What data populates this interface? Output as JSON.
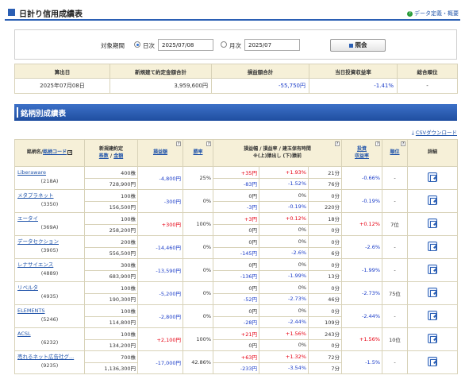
{
  "header": {
    "title": "日計り信用成績表",
    "help_link": "データ定義・概要"
  },
  "filter": {
    "label": "対象期間",
    "daily_label": "日次",
    "daily_value": "2025/07/08",
    "monthly_label": "月次",
    "monthly_value": "2025/07",
    "submit_label": "照会"
  },
  "summary": {
    "headers": [
      "算出日",
      "新規建て約定金額合計",
      "損益額合計",
      "当日投資収益率",
      "総合順位"
    ],
    "row": [
      "2025年07月08日",
      "3,959,600円",
      "-55,750円",
      "-1.41%",
      "-"
    ]
  },
  "section_title": "銘柄別成績表",
  "csv_label": "CSVダウンロード",
  "table": {
    "headers": {
      "name_a": "銘柄名",
      "name_b": "銘柄コード",
      "amount_a": "新規建約定",
      "amount_b": "株数",
      "amount_c": "金額",
      "pnl": "損益額",
      "win": "勝率",
      "range_a": "損益幅 / 損益率 / 建玉保有時間",
      "range_b": "※(上)猿出し (下)猿前",
      "roi_a": "投資",
      "roi_b": "収益率",
      "rank": "順位",
      "detail": "詳細"
    },
    "rows": [
      {
        "name": "Liberaware",
        "code": "(218A)",
        "shares": "400株",
        "amount": "728,900円",
        "pnl": "-4,800円",
        "pnl_c": "blue",
        "win": "25%",
        "up_amt": "+35円",
        "up_amt_c": "red",
        "up_rate": "+1.93%",
        "up_rate_c": "red",
        "up_time": "21分",
        "dn_amt": "-83円",
        "dn_amt_c": "blue",
        "dn_rate": "-1.52%",
        "dn_rate_c": "blue",
        "dn_time": "76分",
        "roi": "-0.66%",
        "roi_c": "blue",
        "rank": "-"
      },
      {
        "name": "メタプラネット",
        "code": "(3350)",
        "shares": "100株",
        "amount": "156,500円",
        "pnl": "-300円",
        "pnl_c": "blue",
        "win": "0%",
        "up_amt": "0円",
        "up_amt_c": "",
        "up_rate": "0%",
        "up_rate_c": "",
        "up_time": "0分",
        "dn_amt": "-3円",
        "dn_amt_c": "blue",
        "dn_rate": "-0.19%",
        "dn_rate_c": "blue",
        "dn_time": "220分",
        "roi": "-0.19%",
        "roi_c": "blue",
        "rank": "-"
      },
      {
        "name": "エータイ",
        "code": "(369A)",
        "shares": "100株",
        "amount": "258,200円",
        "pnl": "+300円",
        "pnl_c": "red",
        "win": "100%",
        "up_amt": "+3円",
        "up_amt_c": "red",
        "up_rate": "+0.12%",
        "up_rate_c": "red",
        "up_time": "18分",
        "dn_amt": "0円",
        "dn_amt_c": "",
        "dn_rate": "0%",
        "dn_rate_c": "",
        "dn_time": "0分",
        "roi": "+0.12%",
        "roi_c": "red",
        "rank": "7位"
      },
      {
        "name": "データセクション",
        "code": "(3905)",
        "shares": "200株",
        "amount": "556,500円",
        "pnl": "-14,460円",
        "pnl_c": "blue",
        "win": "0%",
        "up_amt": "0円",
        "up_amt_c": "",
        "up_rate": "0%",
        "up_rate_c": "",
        "up_time": "0分",
        "dn_amt": "-145円",
        "dn_amt_c": "blue",
        "dn_rate": "-2.6%",
        "dn_rate_c": "blue",
        "dn_time": "6分",
        "roi": "-2.6%",
        "roi_c": "blue",
        "rank": "-"
      },
      {
        "name": "レナサイエンス",
        "code": "(4889)",
        "shares": "300株",
        "amount": "683,900円",
        "pnl": "-13,590円",
        "pnl_c": "blue",
        "win": "0%",
        "up_amt": "0円",
        "up_amt_c": "",
        "up_rate": "0%",
        "up_rate_c": "",
        "up_time": "0分",
        "dn_amt": "-136円",
        "dn_amt_c": "blue",
        "dn_rate": "-1.99%",
        "dn_rate_c": "blue",
        "dn_time": "13分",
        "roi": "-1.99%",
        "roi_c": "blue",
        "rank": "-"
      },
      {
        "name": "リベルタ",
        "code": "(4935)",
        "shares": "100株",
        "amount": "190,300円",
        "pnl": "-5,200円",
        "pnl_c": "blue",
        "win": "0%",
        "up_amt": "0円",
        "up_amt_c": "",
        "up_rate": "0%",
        "up_rate_c": "",
        "up_time": "0分",
        "dn_amt": "-52円",
        "dn_amt_c": "blue",
        "dn_rate": "-2.73%",
        "dn_rate_c": "blue",
        "dn_time": "46分",
        "roi": "-2.73%",
        "roi_c": "blue",
        "rank": "75位"
      },
      {
        "name": "ELEMENTS",
        "code": "(5246)",
        "shares": "100株",
        "amount": "114,800円",
        "pnl": "-2,800円",
        "pnl_c": "blue",
        "win": "0%",
        "up_amt": "0円",
        "up_amt_c": "",
        "up_rate": "0%",
        "up_rate_c": "",
        "up_time": "0分",
        "dn_amt": "-28円",
        "dn_amt_c": "blue",
        "dn_rate": "-2.44%",
        "dn_rate_c": "blue",
        "dn_time": "109分",
        "roi": "-2.44%",
        "roi_c": "blue",
        "rank": "-"
      },
      {
        "name": "ACSL",
        "code": "(6232)",
        "shares": "100株",
        "amount": "134,200円",
        "pnl": "+2,100円",
        "pnl_c": "red",
        "win": "100%",
        "up_amt": "+21円",
        "up_amt_c": "red",
        "up_rate": "+1.56%",
        "up_rate_c": "red",
        "up_time": "243分",
        "dn_amt": "0円",
        "dn_amt_c": "",
        "dn_rate": "0%",
        "dn_rate_c": "",
        "dn_time": "0分",
        "roi": "+1.56%",
        "roi_c": "red",
        "rank": "10位"
      },
      {
        "name": "売れるネット広告社グ...",
        "code": "(9235)",
        "shares": "700株",
        "amount": "1,136,300円",
        "pnl": "-17,000円",
        "pnl_c": "blue",
        "win": "42.86%",
        "up_amt": "+63円",
        "up_amt_c": "red",
        "up_rate": "+1.32%",
        "up_rate_c": "red",
        "up_time": "72分",
        "dn_amt": "-233円",
        "dn_amt_c": "blue",
        "dn_rate": "-3.54%",
        "dn_rate_c": "blue",
        "dn_time": "7分",
        "roi": "-1.5%",
        "roi_c": "blue",
        "rank": "-"
      }
    ]
  }
}
